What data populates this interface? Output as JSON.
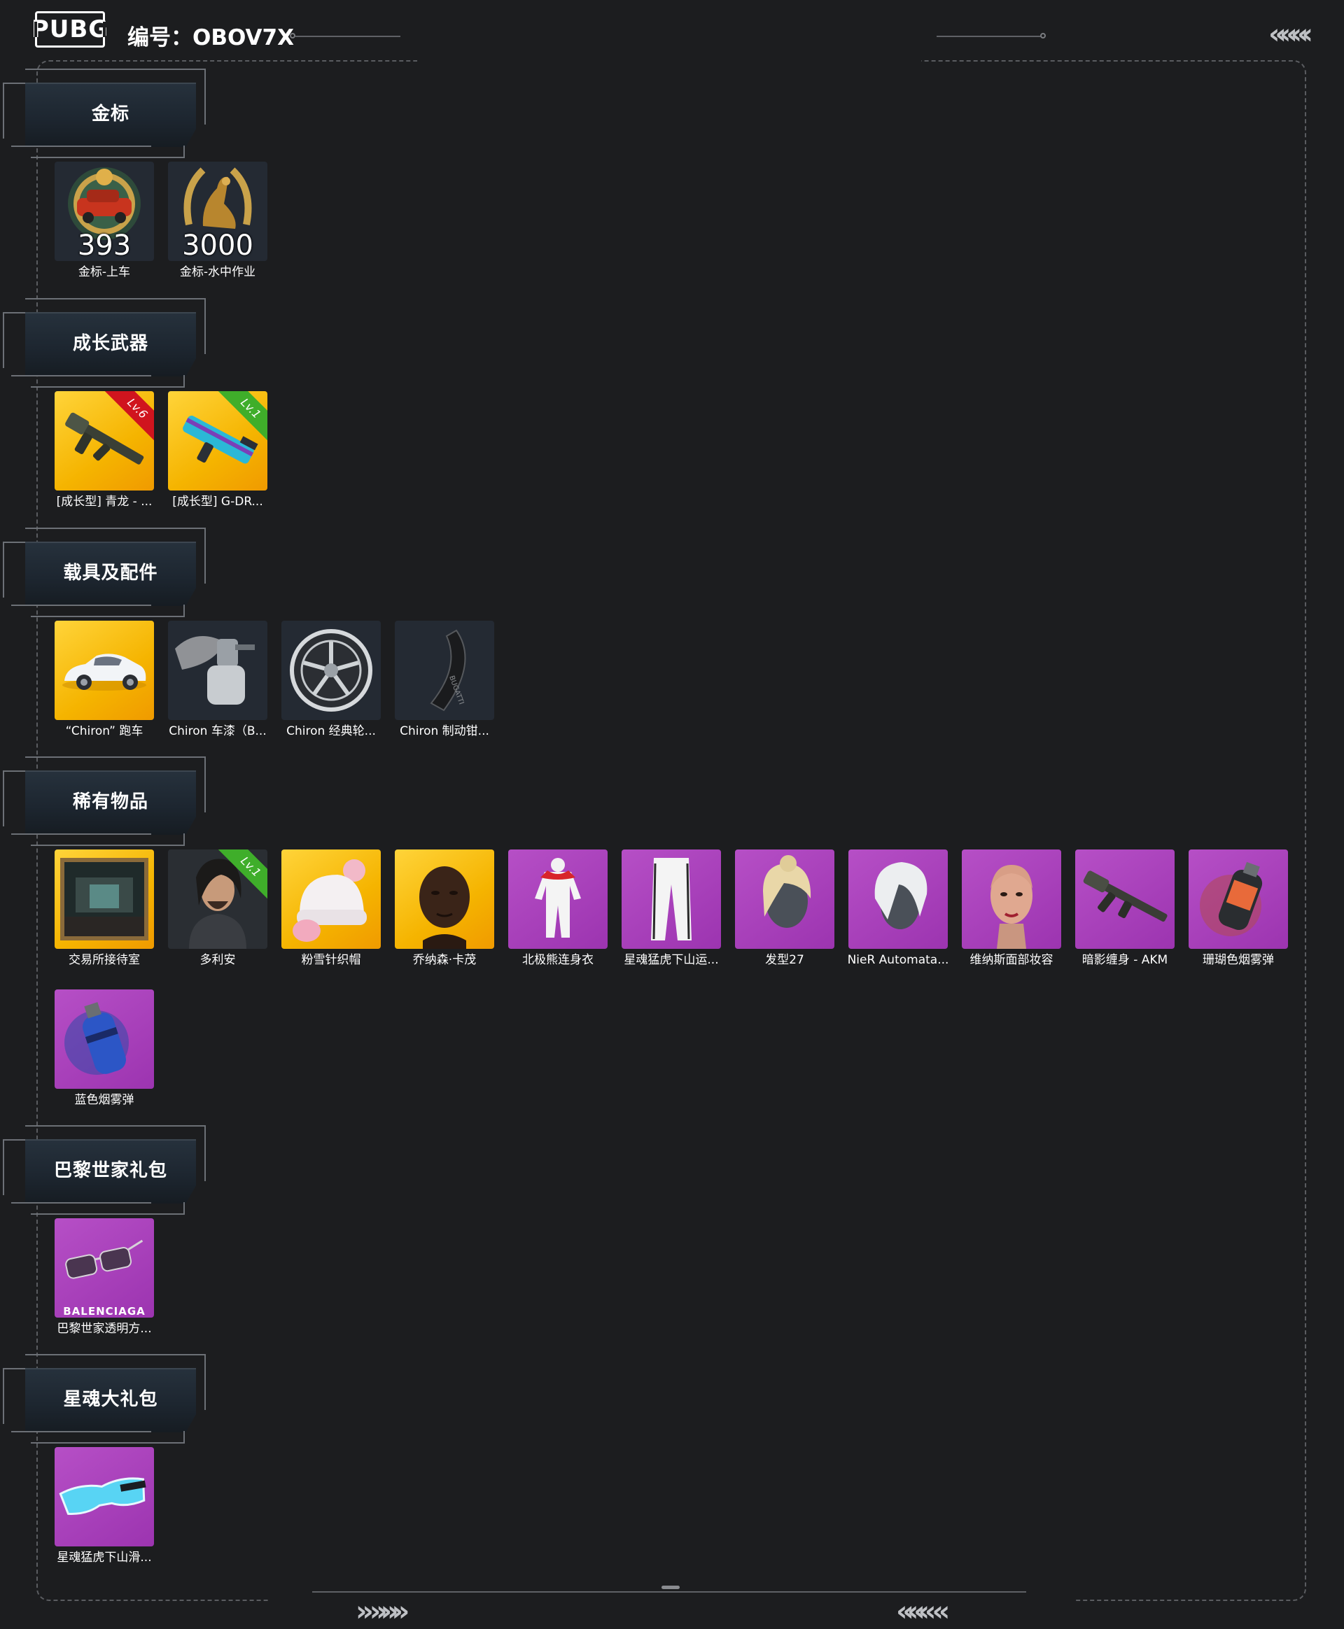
{
  "header": {
    "logo_text": "PUBG",
    "code_label": "编号：OBOV7X"
  },
  "sections": [
    {
      "title": "金标",
      "items": [
        {
          "label": "金标-上车",
          "number": "393",
          "bg": "dark",
          "icon": "gold-badge-car-icon"
        },
        {
          "label": "金标-水中作业",
          "number": "3000",
          "bg": "dark",
          "icon": "gold-badge-seal-icon"
        }
      ]
    },
    {
      "title": "成长武器",
      "items": [
        {
          "label": "[成长型] 青龙 - ...",
          "level": "Lv.6",
          "level_color": "red",
          "bg": "gold",
          "icon": "rifle-icon"
        },
        {
          "label": "[成长型] G-DR...",
          "level": "Lv.1",
          "level_color": "green",
          "bg": "gold",
          "icon": "smg-icon"
        }
      ]
    },
    {
      "title": "载具及配件",
      "items": [
        {
          "label": "“Chiron” 跑车",
          "bg": "gold",
          "icon": "sports-car-icon"
        },
        {
          "label": "Chiron 车漆（B...",
          "bg": "dark",
          "icon": "spray-gun-icon"
        },
        {
          "label": "Chiron 经典轮...",
          "bg": "dark",
          "icon": "wheel-icon"
        },
        {
          "label": "Chiron 制动钳...",
          "bg": "dark",
          "icon": "brake-caliper-icon"
        }
      ]
    },
    {
      "title": "稀有物品",
      "items": [
        {
          "label": "交易所接待室",
          "bg": "gold",
          "icon": "room-picture-icon"
        },
        {
          "label": "多利安",
          "level": "Lv.1",
          "level_color": "green",
          "bg": "dark",
          "icon": "character-portrait-icon"
        },
        {
          "label": "粉雪针织帽",
          "bg": "gold",
          "icon": "knit-hat-icon"
        },
        {
          "label": "乔纳森·卡茂",
          "bg": "gold",
          "icon": "character-face-icon"
        },
        {
          "label": "北极熊连身衣",
          "bg": "purple",
          "icon": "jumpsuit-icon"
        },
        {
          "label": "星魂猛虎下山运...",
          "bg": "purple",
          "icon": "pants-icon"
        },
        {
          "label": "发型27",
          "bg": "purple",
          "icon": "hairstyle-icon"
        },
        {
          "label": "NieR Automata...",
          "bg": "purple",
          "icon": "white-hair-icon"
        },
        {
          "label": "维纳斯面部妆容",
          "bg": "purple",
          "icon": "face-makeup-icon"
        },
        {
          "label": "暗影缠身 - AKM",
          "bg": "purple",
          "icon": "akm-rifle-icon"
        },
        {
          "label": "珊瑚色烟雾弹",
          "bg": "purple",
          "icon": "coral-smoke-grenade-icon"
        },
        {
          "label": "蓝色烟雾弹",
          "bg": "purple",
          "icon": "blue-smoke-grenade-icon"
        }
      ]
    },
    {
      "title": "巴黎世家礼包",
      "items": [
        {
          "label": "巴黎世家透明方...",
          "brand": "BALENCIAGA",
          "bg": "purple",
          "icon": "sunglasses-icon"
        }
      ]
    },
    {
      "title": "星魂大礼包",
      "items": [
        {
          "label": "星魂猛虎下山滑...",
          "bg": "purple",
          "icon": "ski-goggles-icon"
        }
      ]
    }
  ],
  "colors": {
    "background": "#1c1d1f",
    "gold_tile": "#f5b400",
    "purple_tile": "#9c34b0",
    "dark_tile": "#242a33"
  }
}
